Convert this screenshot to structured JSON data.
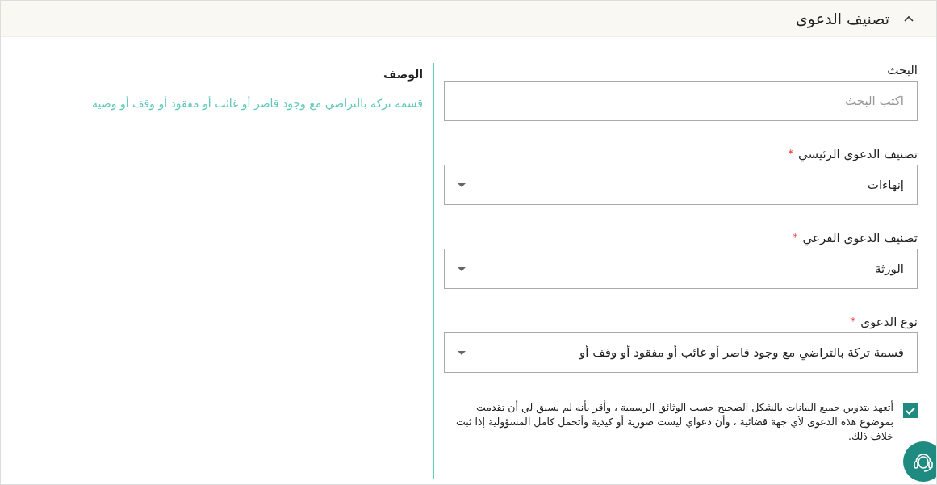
{
  "section": {
    "title": "تصنيف الدعوى",
    "expanded": true
  },
  "fields": [
    {
      "kind": "text",
      "label": "البحث",
      "required": false,
      "placeholder": "اكتب البحث"
    },
    {
      "kind": "select",
      "label": "تصنيف الدعوى الرئيسي",
      "required": true,
      "value": "إنهاءات"
    },
    {
      "kind": "select",
      "label": "تصنيف الدعوى الفرعي",
      "required": true,
      "value": "الورثة"
    },
    {
      "kind": "select",
      "label": "نوع الدعوى",
      "required": true,
      "value": "قسمة تركة بالتراضي مع وجود قاصر أو غائب أو مفقود أو وقف أو"
    }
  ],
  "required_mark": "*",
  "pledge": {
    "checked": true,
    "text": "أتعهد بتدوين جميع البيانات بالشكل الصحيح حسب الوثائق الرسمية ، وأقر بأنه لم يسبق لي أن تقدمت بموضوع هذه الدعوى لأي جهة قضائية ، وأن دعواي ليست صورية أو كيدية وأتحمل كامل المسؤولية إذا ثبت خلاف ذلك."
  },
  "description": {
    "label": "الوصف",
    "text": "قسمة تركة بالتراضي مع وجود قاصر أو غائب أو مفقود أو وقف أو وصية"
  }
}
